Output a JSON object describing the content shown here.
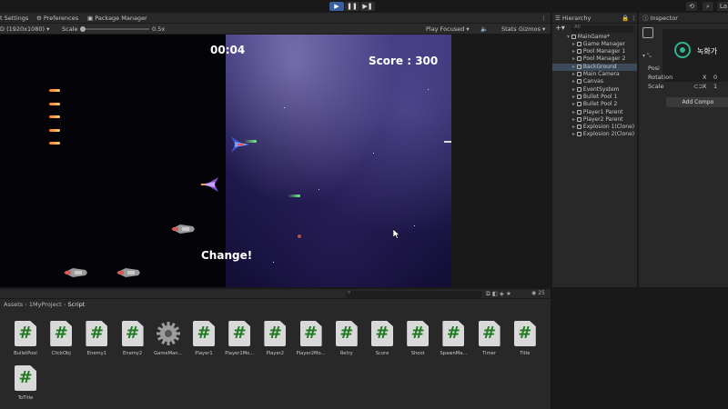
{
  "toolbar": {
    "play": "▶",
    "pause": "❚❚",
    "step": "▶❚",
    "history_icon": "history-icon",
    "search_icon": "search-icon",
    "layers_label": "La"
  },
  "game_tabs": [
    {
      "label": "t Settings"
    },
    {
      "label": "Preferences"
    },
    {
      "label": "Package Manager"
    }
  ],
  "game_bar": {
    "resolution": "D (1920x1080)",
    "scale_label": "Scale",
    "scale_value": "0.5x",
    "play_focused": "Play Focused",
    "stats": "Stats",
    "gizmos": "Gizmos"
  },
  "game": {
    "timer": "00:04",
    "score": "Score : 300",
    "change": "Change!"
  },
  "hierarchy": {
    "tab": "Hierarchy",
    "search_placeholder": "All",
    "items": [
      {
        "label": "MainGame*",
        "indent": 0
      },
      {
        "label": "Game Manager",
        "indent": 1
      },
      {
        "label": "Pool Manager 1",
        "indent": 1
      },
      {
        "label": "Pool Manager 2",
        "indent": 1
      },
      {
        "label": "BackGround",
        "indent": 1
      },
      {
        "label": "Main Camera",
        "indent": 1
      },
      {
        "label": "Canvas",
        "indent": 1
      },
      {
        "label": "EventSystem",
        "indent": 1
      },
      {
        "label": "Bullet Pool 1",
        "indent": 1
      },
      {
        "label": "Bullet Pool 2",
        "indent": 1
      },
      {
        "label": "Player1 Parent",
        "indent": 1
      },
      {
        "label": "Player2 Parent",
        "indent": 1
      },
      {
        "label": "Explosion 1(Clone)",
        "indent": 1
      },
      {
        "label": "Explosion 2(Clone)",
        "indent": 1
      }
    ]
  },
  "inspector": {
    "tab": "Inspector",
    "rec_label": "녹화가",
    "position_label": "Posi",
    "rotation_label": "Rotation",
    "rotation_x": "X",
    "rotation_val": "0",
    "scale_label": "Scale",
    "scale_x": "X",
    "scale_val": "1",
    "add_component": "Add Compo"
  },
  "project": {
    "breadcrumb": [
      "Assets",
      "1MyProject",
      "Script"
    ],
    "file_count": "25",
    "assets": [
      {
        "name": "BulletPool",
        "type": "script"
      },
      {
        "name": "ClickObj",
        "type": "script"
      },
      {
        "name": "Enemy1",
        "type": "script"
      },
      {
        "name": "Enemy2",
        "type": "script"
      },
      {
        "name": "GameMan...",
        "type": "gear"
      },
      {
        "name": "Player1",
        "type": "script"
      },
      {
        "name": "Player1Mo...",
        "type": "script"
      },
      {
        "name": "Player2",
        "type": "script"
      },
      {
        "name": "Player2Mo...",
        "type": "script"
      },
      {
        "name": "Retry",
        "type": "script"
      },
      {
        "name": "Score",
        "type": "script"
      },
      {
        "name": "Shoot",
        "type": "script"
      },
      {
        "name": "SpawnMa...",
        "type": "script"
      },
      {
        "name": "Timer",
        "type": "script"
      },
      {
        "name": "Title",
        "type": "script"
      },
      {
        "name": "ToTitle",
        "type": "script"
      }
    ]
  }
}
